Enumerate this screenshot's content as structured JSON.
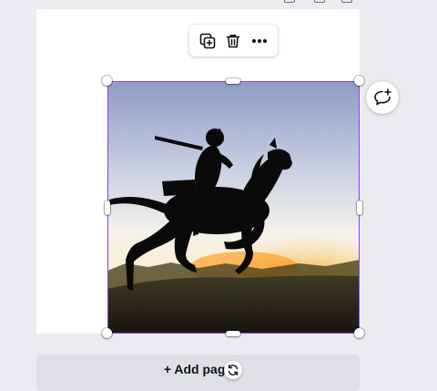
{
  "toolbar": {
    "icons": [
      "duplicate-icon",
      "trash-icon",
      "more-icon"
    ]
  },
  "canvas": {
    "selection_color": "#8b3dff",
    "image_subject": "silhouette-of-knight-on-horseback"
  },
  "comment_button": {
    "icon": "add-comment-icon"
  },
  "add_page": {
    "label": "+ Add page"
  }
}
